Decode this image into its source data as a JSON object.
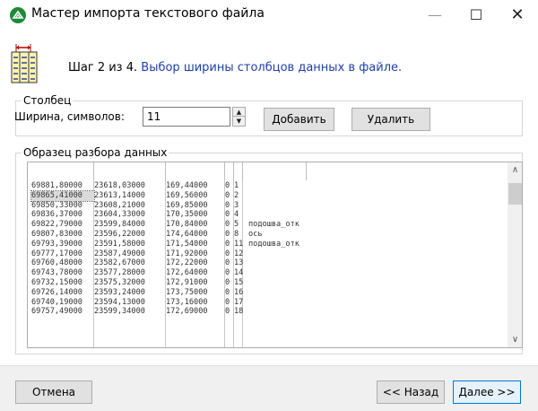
{
  "window": {
    "title": "Мастер импорта текстового файла",
    "minimize_glyph": "—",
    "maximize_glyph": "☐",
    "close_glyph": "✕"
  },
  "step": {
    "prefix": "Шаг 2 из 4.",
    "description": "Выбор ширины столбцов данных в файле."
  },
  "column_group": {
    "legend": "Столбец",
    "width_label": "Ширина, символов:",
    "width_value": "11",
    "add_button": "Добавить",
    "delete_button": "Удалить"
  },
  "sample_group": {
    "legend": "Образец разбора данных",
    "rows": [
      [
        "69881,80000",
        "23618,03000",
        "169,44000",
        "0",
        "1",
        ""
      ],
      [
        "69865,41000",
        "23613,14000",
        "169,56000",
        "0",
        "2",
        ""
      ],
      [
        "69850,33000",
        "23608,21000",
        "169,85000",
        "0",
        "3",
        ""
      ],
      [
        "69836,37000",
        "23604,33000",
        "170,35000",
        "0",
        "4",
        ""
      ],
      [
        "69822,79000",
        "23599,84000",
        "170,84000",
        "0",
        "5",
        "подошва_отк"
      ],
      [
        "69807,83000",
        "23596,22000",
        "174,64000",
        "0",
        "8",
        "ось"
      ],
      [
        "69793,39000",
        "23591,58000",
        "171,54000",
        "0",
        "11",
        "подошва_отк"
      ],
      [
        "69777,17000",
        "23587,49000",
        "171,92000",
        "0",
        "12",
        ""
      ],
      [
        "69760,48000",
        "23582,67000",
        "172,22000",
        "0",
        "13",
        ""
      ],
      [
        "69743,78000",
        "23577,28000",
        "172,64000",
        "0",
        "14",
        ""
      ],
      [
        "69732,15000",
        "23575,32000",
        "172,91000",
        "0",
        "15",
        ""
      ],
      [
        "69726,14000",
        "23593,24000",
        "173,75000",
        "0",
        "16",
        ""
      ],
      [
        "69740,19000",
        "23594,13000",
        "173,16000",
        "0",
        "17",
        ""
      ],
      [
        "69757,49000",
        "23599,34000",
        "172,69000",
        "0",
        "18",
        ""
      ]
    ],
    "selected_cell": "69865,41000",
    "scroll_up_glyph": "∧",
    "scroll_down_glyph": "∨"
  },
  "footer": {
    "cancel_button": "Отмена",
    "back_button": "<< Назад",
    "next_button": "Далее >>"
  },
  "colors": {
    "accent_blue": "#1f3fa8",
    "app_icon_green": "#1d8a3a",
    "default_button_border": "#0078d7"
  }
}
